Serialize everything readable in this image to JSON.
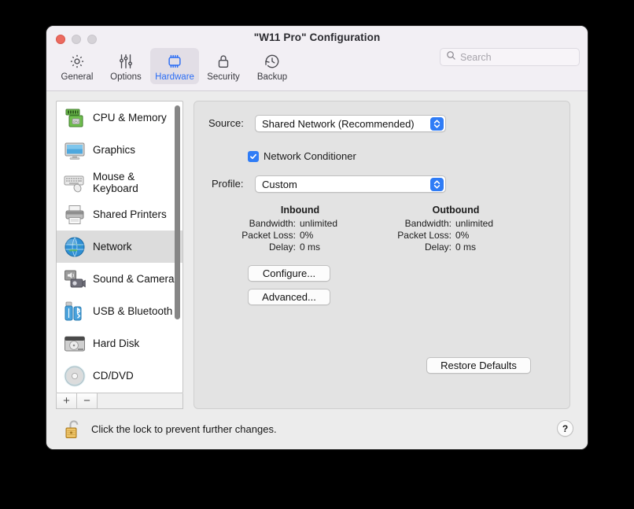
{
  "window": {
    "title": "\"W11 Pro\" Configuration",
    "traffic_lights": [
      "close",
      "minimize",
      "zoom"
    ],
    "accent_color": "#2f7cf6"
  },
  "toolbar": {
    "tabs": [
      {
        "label": "General",
        "icon": "gear-icon",
        "selected": false
      },
      {
        "label": "Options",
        "icon": "sliders-icon",
        "selected": false
      },
      {
        "label": "Hardware",
        "icon": "cpu-chip-icon",
        "selected": true
      },
      {
        "label": "Security",
        "icon": "lock-icon",
        "selected": false
      },
      {
        "label": "Backup",
        "icon": "clock-arrow-icon",
        "selected": false
      }
    ],
    "search": {
      "placeholder": "Search",
      "value": "",
      "icon": "search-icon"
    }
  },
  "sidebar": {
    "items": [
      {
        "label": "CPU & Memory",
        "icon": "memory-chip-icon",
        "selected": false
      },
      {
        "label": "Graphics",
        "icon": "display-icon",
        "selected": false
      },
      {
        "label": "Mouse & Keyboard",
        "icon": "keyboard-icon",
        "selected": false
      },
      {
        "label": "Shared Printers",
        "icon": "printer-icon",
        "selected": false
      },
      {
        "label": "Network",
        "icon": "globe-icon",
        "selected": true
      },
      {
        "label": "Sound & Camera",
        "icon": "speaker-camera-icon",
        "selected": false
      },
      {
        "label": "USB & Bluetooth",
        "icon": "usb-bluetooth-icon",
        "selected": false
      },
      {
        "label": "Hard Disk",
        "icon": "hard-disk-icon",
        "selected": false
      },
      {
        "label": "CD/DVD",
        "icon": "optical-disc-icon",
        "selected": false
      }
    ],
    "footer": {
      "add_label": "+",
      "remove_label": "−"
    }
  },
  "main": {
    "source": {
      "label": "Source:",
      "value": "Shared Network (Recommended)"
    },
    "conditioner": {
      "label": "Network Conditioner",
      "checked": true
    },
    "profile": {
      "label": "Profile:",
      "value": "Custom"
    },
    "stats": {
      "inbound": {
        "heading": "Inbound",
        "rows": [
          {
            "key": "Bandwidth:",
            "value": "unlimited"
          },
          {
            "key": "Packet Loss:",
            "value": "0%"
          },
          {
            "key": "Delay:",
            "value": "0 ms"
          }
        ]
      },
      "outbound": {
        "heading": "Outbound",
        "rows": [
          {
            "key": "Bandwidth:",
            "value": "unlimited"
          },
          {
            "key": "Packet Loss:",
            "value": "0%"
          },
          {
            "key": "Delay:",
            "value": "0 ms"
          }
        ]
      }
    },
    "buttons": {
      "configure": "Configure...",
      "advanced": "Advanced...",
      "restore": "Restore Defaults"
    }
  },
  "footer": {
    "lock_text": "Click the lock to prevent further changes.",
    "lock_icon": "open-padlock-icon",
    "help_label": "?"
  }
}
